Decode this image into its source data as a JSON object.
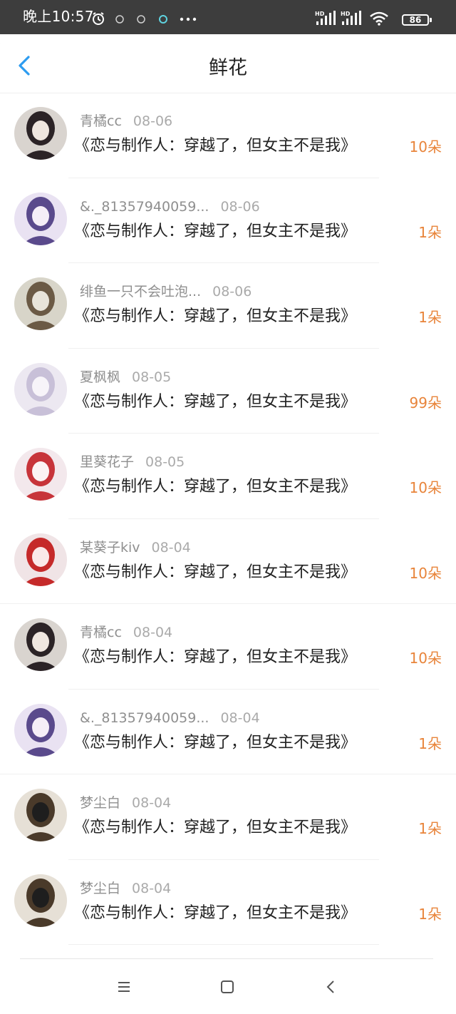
{
  "status_bar": {
    "time": "晚上10:57",
    "icons_left": [
      "alarm-icon",
      "notification-icon",
      "notification-icon",
      "app-icon",
      "more-dots-icon"
    ],
    "more": "•••",
    "network_label_1": "HD",
    "network_label_2": "HD",
    "battery": "86"
  },
  "header": {
    "back_icon": "chevron-left-icon",
    "title": "鲜花"
  },
  "entries": [
    {
      "name": "青橘cc",
      "date": "08-06",
      "book": "《恋与制作人：穿越了，但女主不是我》",
      "count": "10朵"
    },
    {
      "name": "&._81357940059...",
      "date": "08-06",
      "book": "《恋与制作人：穿越了，但女主不是我》",
      "count": "1朵"
    },
    {
      "name": "绯鱼一只不会吐泡...",
      "date": "08-06",
      "book": "《恋与制作人：穿越了，但女主不是我》",
      "count": "1朵"
    },
    {
      "name": "夏枫枫",
      "date": "08-05",
      "book": "《恋与制作人：穿越了，但女主不是我》",
      "count": "99朵"
    },
    {
      "name": "里葵花子",
      "date": "08-05",
      "book": "《恋与制作人：穿越了，但女主不是我》",
      "count": "10朵"
    },
    {
      "name": "某葵子kiv",
      "date": "08-04",
      "book": "《恋与制作人：穿越了，但女主不是我》",
      "count": "10朵"
    },
    {
      "name": "青橘cc",
      "date": "08-04",
      "book": "《恋与制作人：穿越了，但女主不是我》",
      "count": "10朵"
    },
    {
      "name": "&._81357940059...",
      "date": "08-04",
      "book": "《恋与制作人：穿越了，但女主不是我》",
      "count": "1朵"
    },
    {
      "name": "梦尘白",
      "date": "08-04",
      "book": "《恋与制作人：穿越了，但女主不是我》",
      "count": "1朵"
    },
    {
      "name": "梦尘白",
      "date": "08-04",
      "book": "《恋与制作人：穿越了，但女主不是我》",
      "count": "1朵"
    }
  ],
  "nav_bar": {
    "icons": [
      "menu-icon",
      "home-square-icon",
      "back-chevron-icon"
    ]
  },
  "colors": {
    "accent": "#2d9cf0",
    "count": "#e8843a",
    "status_bar_bg": "#3d3d3d"
  }
}
